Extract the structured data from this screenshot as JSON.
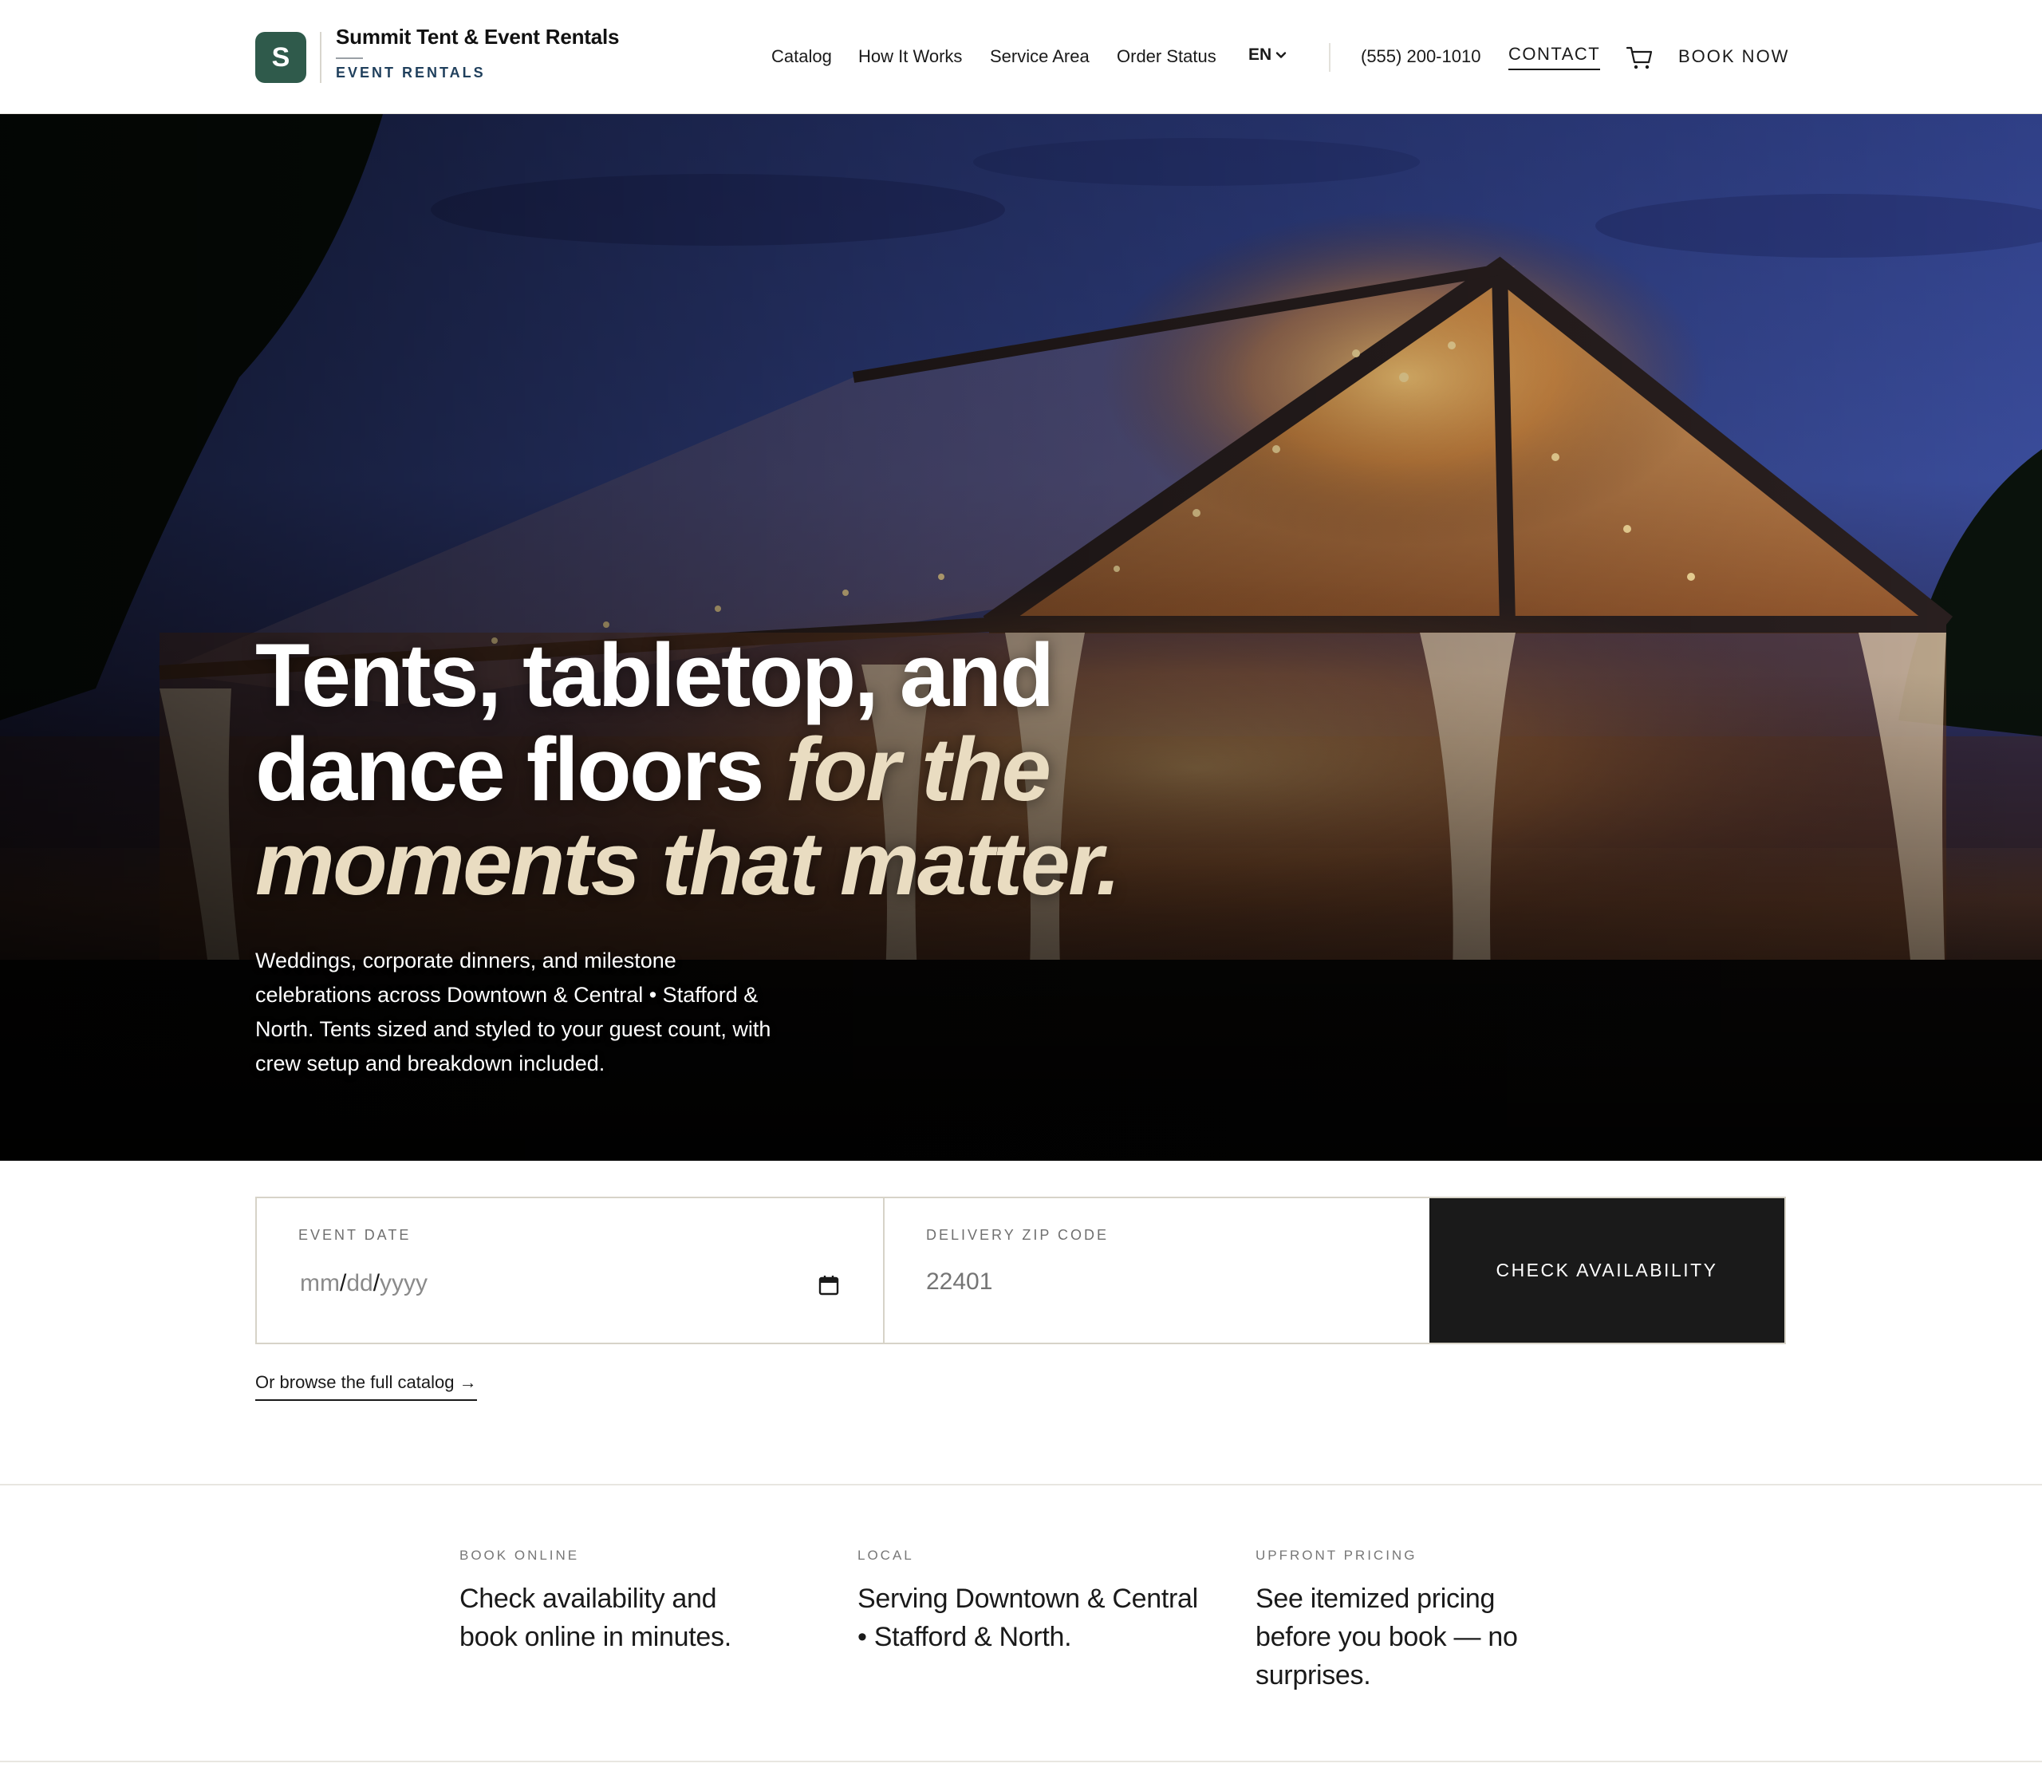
{
  "brand": {
    "badge_letter": "S",
    "name": "Summit Tent & Event Rentals",
    "tagline": "EVENT RENTALS",
    "accent_color": "#2f5a4b"
  },
  "nav": {
    "items": [
      {
        "label": "Catalog"
      },
      {
        "label": "How It Works"
      },
      {
        "label": "Service Area"
      },
      {
        "label": "Order Status"
      }
    ],
    "language": "EN",
    "phone": "(555) 200-1010",
    "contact_label": "CONTACT",
    "cart_icon": "cart-icon",
    "book_now_label": "BOOK NOW"
  },
  "hero": {
    "title_plain_1": "Tents, tabletop, and",
    "title_plain_2": "dance floors ",
    "title_accent_1": "for the",
    "title_accent_2": "moments that matter.",
    "subtitle": "Weddings, corporate dinners, and milestone celebrations across Downtown & Central • Stafford & North. Tents sized and styled to your guest count, with crew setup and breakdown included.",
    "accent_color": "#e9dcc1"
  },
  "booking": {
    "date_label": "EVENT DATE",
    "date_mm": "mm",
    "date_dd": "dd",
    "date_yyyy": "yyyy",
    "date_separator": "/",
    "zip_label": "DELIVERY ZIP CODE",
    "zip_placeholder": "22401",
    "check_button": "CHECK AVAILABILITY",
    "browse_link": "Or browse the full catalog →"
  },
  "features": [
    {
      "eyebrow": "BOOK ONLINE",
      "text": "Check availability and book online in minutes."
    },
    {
      "eyebrow": "LOCAL",
      "text": "Serving Downtown & Central • Stafford & North."
    },
    {
      "eyebrow": "UPFRONT PRICING",
      "text": "See itemized pricing before you book — no surprises."
    }
  ]
}
